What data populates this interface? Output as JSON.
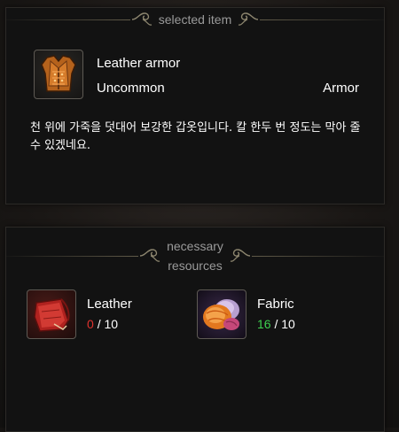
{
  "selected_item": {
    "header": "selected item",
    "name": "Leather armor",
    "rarity": "Uncommon",
    "type": "Armor",
    "description": "천 위에 가죽을 덧대어 보강한 갑옷입니다. 칼 한두 번 정도는 막아 줄 수 있겠네요.",
    "icon": "leather-armor-icon"
  },
  "resources": {
    "header_line1": "necessary",
    "header_line2": "resources",
    "items": [
      {
        "name": "Leather",
        "have": "0",
        "need": "/ 10",
        "icon": "leather-icon",
        "have_color": "#e0322e"
      },
      {
        "name": "Fabric",
        "have": "16",
        "need": "/ 10",
        "icon": "fabric-icon",
        "have_color": "#3ed14f"
      }
    ]
  }
}
